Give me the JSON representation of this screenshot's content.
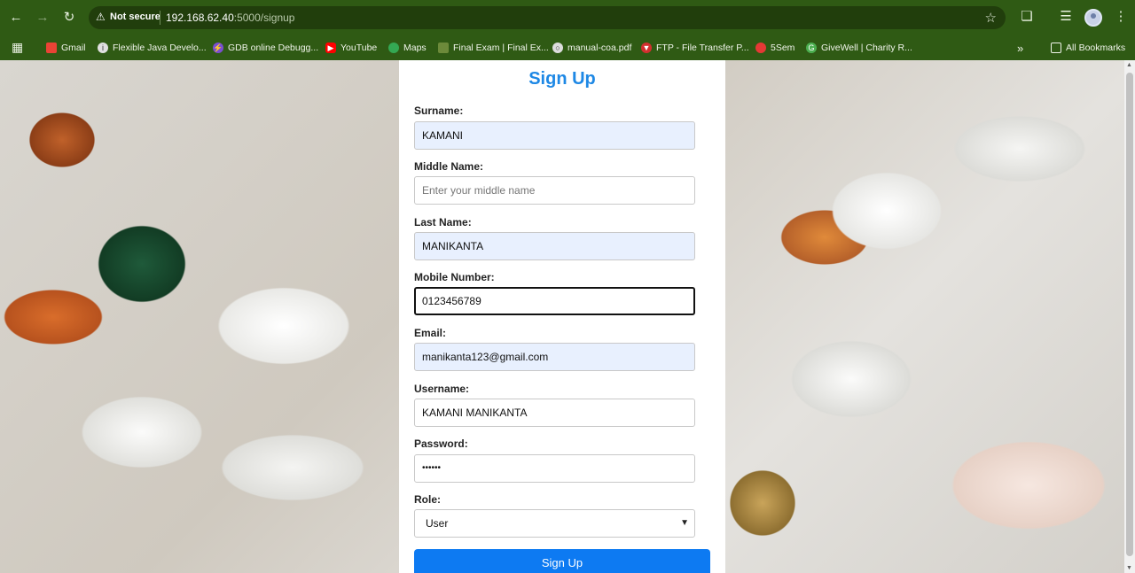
{
  "browser": {
    "security_label": "Not secure",
    "url_host": "192.168.62.40",
    "url_path": ":5000/signup",
    "bookmarks": [
      {
        "label": "Gmail",
        "color": "#ea4335"
      },
      {
        "label": "Flexible Java Develo...",
        "color": "#e0e0e0"
      },
      {
        "label": "GDB online Debugg...",
        "color": "#7b4fd1"
      },
      {
        "label": "YouTube",
        "color": "#ff0000"
      },
      {
        "label": "Maps",
        "color": "#34a853"
      },
      {
        "label": "Final Exam | Final Ex...",
        "color": "#6c8a3a"
      },
      {
        "label": "manual-coa.pdf",
        "color": "#dddddd"
      },
      {
        "label": "FTP - File Transfer P...",
        "color": "#d32f2f"
      },
      {
        "label": "5Sem",
        "color": "#e53935"
      },
      {
        "label": "GiveWell | Charity R...",
        "color": "#4caf50"
      }
    ],
    "more_label": "»",
    "all_bookmarks_label": "All Bookmarks"
  },
  "form": {
    "title": "Sign Up",
    "fields": [
      {
        "label": "Surname:",
        "value": "KAMANI"
      },
      {
        "label": "Middle Name:",
        "placeholder": "Enter your middle name"
      },
      {
        "label": "Last Name:",
        "value": "MANIKANTA"
      },
      {
        "label": "Mobile Number:",
        "value": "0123456789"
      },
      {
        "label": "Email:",
        "value": "manikanta123@gmail.com"
      },
      {
        "label": "Username:",
        "value": "KAMANI MANIKANTA"
      },
      {
        "label": "Password:",
        "value": "••••••"
      },
      {
        "label": "Role:",
        "value": "User"
      }
    ],
    "submit_label": "Sign Up"
  },
  "colors": {
    "accent": "#1e88e5",
    "button": "#0d7af2",
    "chrome": "#2f5a14",
    "autofill": "#e8f0fe"
  }
}
